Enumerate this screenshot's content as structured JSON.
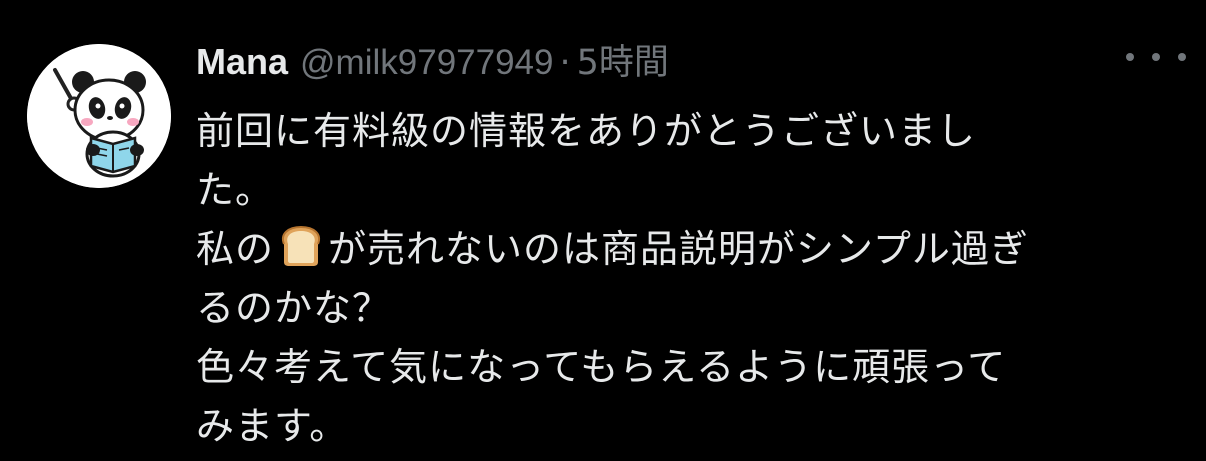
{
  "tweet": {
    "author_name": "Mana",
    "author_handle": "@milk97977949",
    "separator": "·",
    "time": "5時間",
    "avatar_icon": "panda-reading-avatar",
    "more_icon": "more-options-icon",
    "body": {
      "line1": "前回に有料級の情報をありがとうございまし",
      "line2": "た。",
      "line3_before": "私の",
      "line3_emoji": "bread-emoji",
      "line3_after": "が売れないのは商品説明がシンプル過ぎ",
      "line4": "るのかな？",
      "line5": "色々考えて気になってもらえるように頑張って",
      "line6": "みます。"
    }
  },
  "colors": {
    "background": "#000000",
    "primary_text": "#e7e9ea",
    "secondary_text": "#71767b"
  }
}
